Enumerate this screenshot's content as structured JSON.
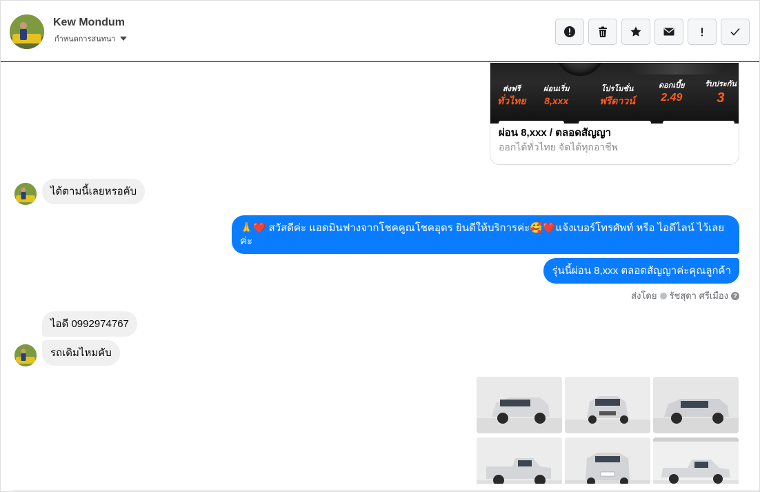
{
  "header": {
    "contact_name": "Kew Mondum",
    "assign_label": "กำหนดการสนทนา"
  },
  "toolbar": {
    "buttons": [
      {
        "icon": "alert-circle-icon"
      },
      {
        "icon": "trash-icon"
      },
      {
        "icon": "star-icon"
      },
      {
        "icon": "envelope-icon"
      },
      {
        "icon": "exclamation-icon"
      },
      {
        "icon": "checkmark-icon"
      }
    ]
  },
  "ad_card": {
    "promos": [
      {
        "white": "ส่งฟรี",
        "orange": "ทั่วไทย"
      },
      {
        "white": "ผ่อนเริ่ม",
        "orange": "8,xxx"
      },
      {
        "white": "โปรโมชั่น",
        "orange": "ฟรีดาวน์"
      },
      {
        "white": "ดอกเบี้ย",
        "orange": "2.49"
      },
      {
        "white": "รับประกัน",
        "orange": "3"
      }
    ],
    "title": "ผ่อน 8,xxx / ตลอดสัญญา",
    "subtitle": "ออกได้ทั่วไทย จัดได้ทุกอาชีพ"
  },
  "messages": {
    "m1": "ได้ตามนี้เลยหรอคับ",
    "m2_line1": "🙏❤️ สวัสดีค่ะ แอดมินฟางจากโชคคูณโชคอุดร ยินดีให้บริการค่ะ🥰❤️แจ้งเบอร์โทรศัพท์ หรือ ไอดีไลน์  ไว้เลย",
    "m2_line2": "ค่ะ",
    "m3": "รุ่นนี้ผ่อน 8,xxx ตลอดสัญญาค่ะคุณลูกค้า",
    "m4": "ไอดี  0992974767",
    "m5": "รถเดิมไหมคับ"
  },
  "sent_by": {
    "prefix": "ส่งโดย",
    "name": "รัชสุดา ศรีเมือง"
  }
}
